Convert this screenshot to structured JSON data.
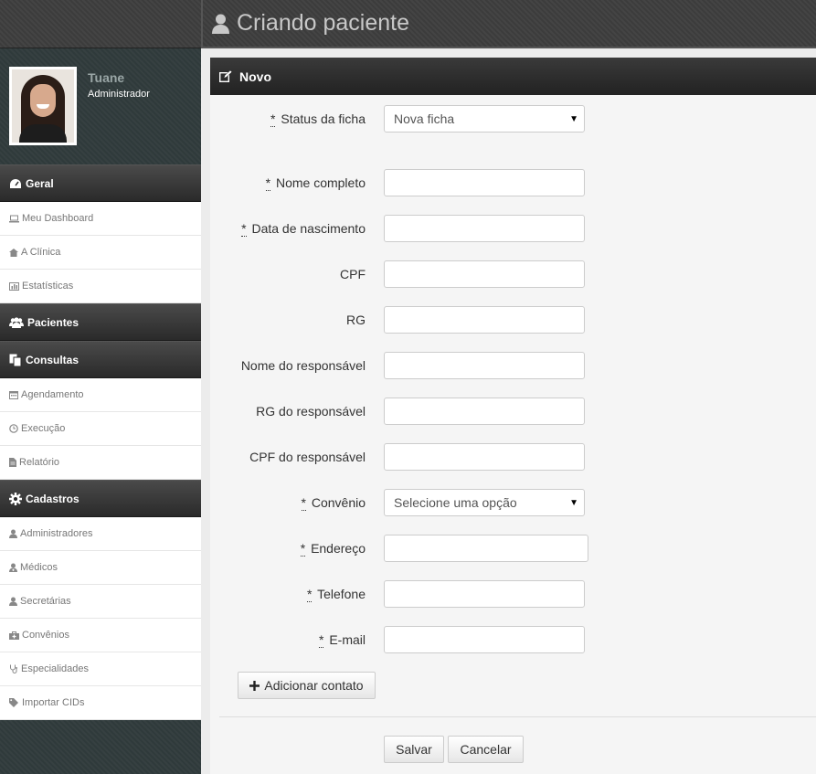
{
  "header": {
    "title": "Criando paciente"
  },
  "profile": {
    "name": "Tuane",
    "role": "Administrador"
  },
  "sidebar": {
    "sections": [
      {
        "label": "Geral",
        "items": [
          "Meu Dashboard",
          "A Clínica",
          "Estatísticas"
        ]
      },
      {
        "label": "Pacientes",
        "items": []
      },
      {
        "label": "Consultas",
        "items": [
          "Agendamento",
          "Execução",
          "Relatório"
        ]
      },
      {
        "label": "Cadastros",
        "items": [
          "Administradores",
          "Médicos",
          "Secretárias",
          "Convênios",
          "Especialidades",
          "Importar CIDs"
        ]
      }
    ]
  },
  "panel": {
    "title": "Novo"
  },
  "form": {
    "required_mark": "*",
    "status": {
      "label": "Status da ficha",
      "value": "Nova ficha"
    },
    "nome": {
      "label": "Nome completo"
    },
    "nascimento": {
      "label": "Data de nascimento"
    },
    "cpf": {
      "label": "CPF"
    },
    "rg": {
      "label": "RG"
    },
    "nome_responsavel": {
      "label": "Nome do responsável"
    },
    "rg_responsavel": {
      "label": "RG do responsável"
    },
    "cpf_responsavel": {
      "label": "CPF do responsável"
    },
    "convenio": {
      "label": "Convênio",
      "value": "Selecione uma opção"
    },
    "endereco": {
      "label": "Endereço"
    },
    "telefone": {
      "label": "Telefone"
    },
    "email": {
      "label": "E-mail"
    }
  },
  "buttons": {
    "add_contact": "Adicionar contato",
    "save": "Salvar",
    "cancel": "Cancelar"
  },
  "colors": {
    "sidebar_bg": "#2f3a3b",
    "header_bg": "#3c3c3c",
    "panel_head": "#222222"
  }
}
